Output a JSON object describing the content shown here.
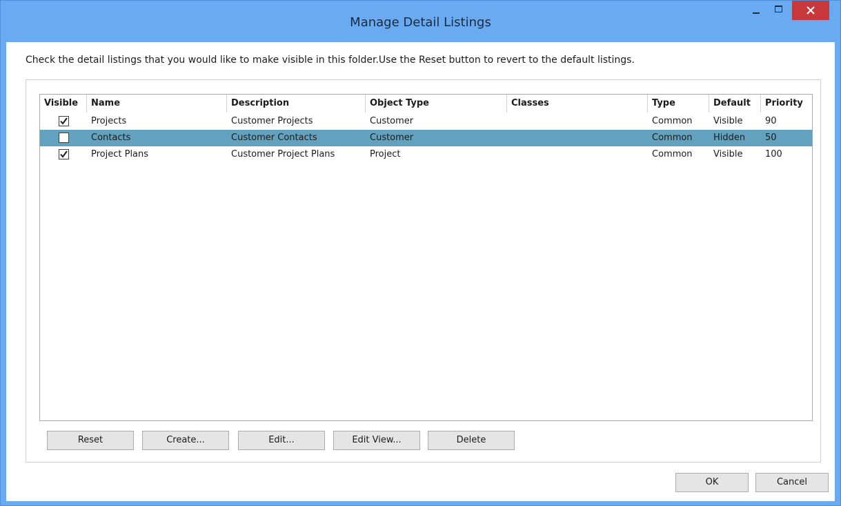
{
  "window": {
    "title": "Manage Detail Listings"
  },
  "instructions": "Check the detail listings that you would like to make visible in this folder.Use the Reset button to revert to the default listings.",
  "table": {
    "columns": [
      "Visible",
      "Name",
      "Description",
      "Object Type",
      "Classes",
      "Type",
      "Default",
      "Priority"
    ],
    "rows": [
      {
        "visible": true,
        "name": "Projects",
        "description": "Customer Projects",
        "object_type": "Customer",
        "classes": "",
        "type": "Common",
        "default": "Visible",
        "priority": "90",
        "selected": false
      },
      {
        "visible": false,
        "name": "Contacts",
        "description": "Customer Contacts",
        "object_type": "Customer",
        "classes": "",
        "type": "Common",
        "default": "Hidden",
        "priority": "50",
        "selected": true
      },
      {
        "visible": true,
        "name": "Project Plans",
        "description": "Customer Project Plans",
        "object_type": "Project",
        "classes": "",
        "type": "Common",
        "default": "Visible",
        "priority": "100",
        "selected": false
      }
    ]
  },
  "buttons": {
    "reset": "Reset",
    "create": "Create...",
    "edit": "Edit...",
    "edit_view": "Edit View...",
    "delete": "Delete",
    "ok": "OK",
    "cancel": "Cancel"
  },
  "colors": {
    "titlebar": "#6aaaf0",
    "close": "#c7373b",
    "selection": "#63a2bf"
  },
  "icons": {
    "minimize": "minimize-icon",
    "maximize": "maximize-icon",
    "close": "close-icon",
    "check": "checkmark-icon"
  }
}
